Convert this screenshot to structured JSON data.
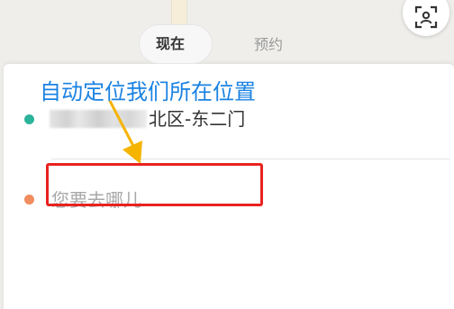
{
  "map": {
    "background_color": "#efeeeb",
    "locate_icon": "locate-crosshair-icon"
  },
  "sheet": {
    "tabs": [
      {
        "label": "现在",
        "active": true
      },
      {
        "label": "预约",
        "active": false
      }
    ],
    "origin": {
      "dot_color": "#2bb39b",
      "address_visible": "北区-东二门"
    },
    "destination": {
      "dot_color": "#f08c5d",
      "placeholder": "您要去哪儿"
    }
  },
  "annotation": {
    "text": "自动定位我们所在位置",
    "text_color": "#1a82e2",
    "arrow_color": "#f5b400",
    "box_color": "#e8231f"
  }
}
